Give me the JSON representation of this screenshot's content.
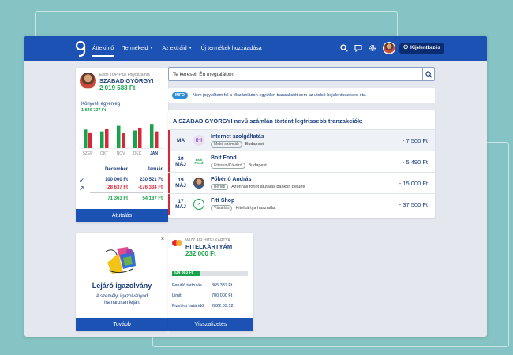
{
  "nav": {
    "items": [
      "Áttekintő",
      "Termékeid",
      "Az extráid",
      "Új termékek hozzáadása"
    ],
    "logout": "Kijelentkezés"
  },
  "account": {
    "type": "Erste TOP Plus Folyószámla",
    "name": "SZABAD GYÖRGYI",
    "balance": "2 019 588 Ft",
    "booked_label": "Könyvelt egyenleg",
    "booked_value": "1 849 727 Ft",
    "button": "Átutalás"
  },
  "chart_data": {
    "type": "bar",
    "categories": [
      "SZEP",
      "OKT",
      "NOV",
      "DEC",
      "JAN"
    ],
    "series": [
      {
        "name": "income",
        "color": "#1aa34a",
        "values": [
          1.0,
          0.9,
          1.2,
          0.95,
          1.3
        ]
      },
      {
        "name": "expense",
        "color": "#d7283a",
        "values": [
          0.85,
          1.05,
          0.8,
          1.1,
          0.9
        ]
      }
    ]
  },
  "comparison": {
    "headers": [
      "December",
      "Január"
    ],
    "income": [
      "100 000 Ft",
      "230 521 Ft"
    ],
    "expense": [
      "-28 637 Ft",
      "-176 334 Ft"
    ],
    "net": [
      "71 363 Ft",
      "54 187 Ft"
    ]
  },
  "search": {
    "placeholder": "Te keresel. Én megtalálom."
  },
  "info": {
    "badge": "INFO",
    "text": "Nem jogyzőtem fel a főszámládon egyetlen tranzakciót sem az utolsó bejelentkezésed óta."
  },
  "transactions": {
    "title": "A SZABAD GYÖRGYI nevű számlán történt legfrissebb tranzakciók:",
    "rows": [
      {
        "day": "MA",
        "month": "",
        "name": "Internet szolgáltatás",
        "tag": "Mobil számlák",
        "place": "Budapest",
        "amount": "- 7 500 Ft"
      },
      {
        "day": "19",
        "month": "MÁJ",
        "name": "Bolt Food",
        "tag": "Étterem/Kávézó",
        "place": "Budapest",
        "amount": "- 5 490 Ft"
      },
      {
        "day": "19",
        "month": "MÁJ",
        "name": "Főbérlő András",
        "tag": "Bérleti",
        "place": "Azonnali forint átutalás bankon belülre",
        "amount": "- 15 000 Ft"
      },
      {
        "day": "17",
        "month": "MÁJ",
        "name": "Fitt Shop",
        "tag": "Vásárlás",
        "place": "Hitelkártya használat",
        "amount": "- 37 500 Ft"
      }
    ]
  },
  "icons": {
    "tx1": "antenna-icon",
    "tx2": "bolt-food-icon",
    "tx3": "person-icon",
    "tx4": "fitt-shop-icon"
  },
  "expire": {
    "title": "Lejáró igazolvány",
    "text": "A személyi igazolványod hamarosan lejárt",
    "button": "Tovább",
    "close": "×"
  },
  "credit": {
    "type": "WIZZ AIR HITELKÁRTYA",
    "name": "HITELKÁRTYÁM",
    "balance": "232 000 Ft",
    "progress_label": "334 863 Ft",
    "progress": 0.36,
    "rows": [
      {
        "k": "Fenáló tartozás",
        "v": "365 337 Ft"
      },
      {
        "k": "Limit",
        "v": "700 000 Ft"
      },
      {
        "k": "Fizetési határidő",
        "v": "2022.09.12."
      }
    ],
    "button": "Visszafizetés"
  }
}
